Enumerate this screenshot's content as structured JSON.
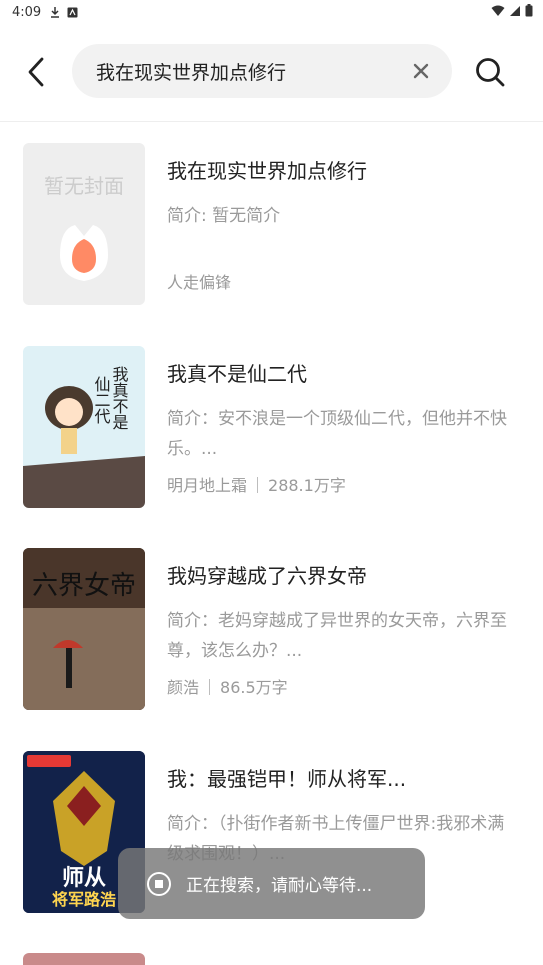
{
  "status_bar": {
    "time": "4:09"
  },
  "header": {
    "query": "我在现实世界加点修行"
  },
  "books": [
    {
      "title": "我在现实世界加点修行",
      "intro": "简介: 暂无简介",
      "author": "人走偏锋",
      "word_count": "",
      "cover_text": "暂无封面"
    },
    {
      "title": "我真不是仙二代",
      "intro": "简介：安不浪是一个顶级仙二代，但他并不快乐。...",
      "author": "明月地上霜",
      "word_count": "288.1万字",
      "cover_text": "我真不是仙二代"
    },
    {
      "title": "我妈穿越成了六界女帝",
      "intro": "简介：老妈穿越成了异世界的女天帝，六界至尊，该怎么办？...",
      "author": "颜浩",
      "word_count": "86.5万字",
      "cover_text": "六界女帝"
    },
    {
      "title": "我：最强铠甲！师从将军...",
      "intro": "简介：（扑街作者新书上传僵尸世界:我邪术满级求围观！）...",
      "author": "",
      "word_count": "",
      "cover_text": "师从将军路浩"
    }
  ],
  "toast": {
    "text": "正在搜索，请耐心等待..."
  },
  "colors": {
    "accent": "#ff7a45",
    "text_secondary": "#9a9a9a",
    "search_bg": "#f2f2f2"
  }
}
